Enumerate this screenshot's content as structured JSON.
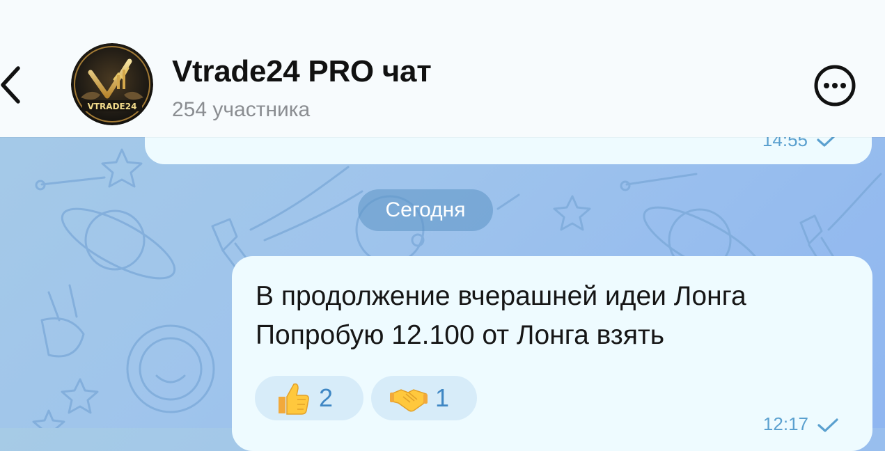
{
  "header": {
    "title": "Vtrade24 PRO чат",
    "subtitle": "254 участника",
    "avatar_text": "VTRADE24",
    "back_icon": "chevron-left-icon",
    "more_icon": "more-horizontal-icon"
  },
  "previous_message": {
    "time": "14:55",
    "status_icon": "check-icon"
  },
  "date_separator": "Сегодня",
  "message": {
    "lines": [
      "В продолжение вчерашней идеи Лонга",
      "Попробую 12.100 от Лонга взять"
    ],
    "reactions": [
      {
        "emoji": "thumbs-up-icon",
        "count": "2"
      },
      {
        "emoji": "handshake-icon",
        "count": "1"
      }
    ],
    "time": "12:17",
    "status_icon": "check-icon"
  },
  "colors": {
    "header_bg": "#f7fbfd",
    "bubble_bg": "#eefbff",
    "accent": "#3f87c4",
    "date_chip_bg": "#5b94c4"
  }
}
